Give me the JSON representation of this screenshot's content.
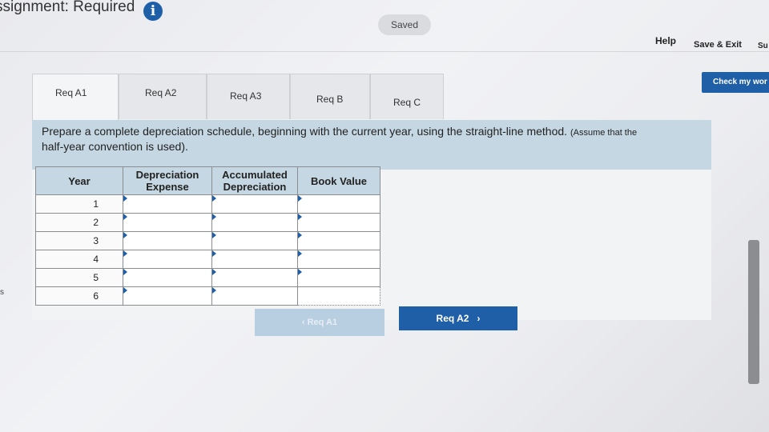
{
  "header": {
    "title": "ssignment: Required",
    "saved_label": "Saved",
    "help_label": "Help",
    "save_exit_label": "Save & Exit",
    "submit_label": "Su",
    "check_work_label": "Check my wor"
  },
  "tabs": [
    {
      "label": "Req A1",
      "active": true
    },
    {
      "label": "Req A2",
      "active": false
    },
    {
      "label": "Req A3",
      "active": false
    },
    {
      "label": "Req B",
      "active": false
    },
    {
      "label": "Req C",
      "active": false
    }
  ],
  "prompt": {
    "main": "Prepare a complete depreciation schedule, beginning with the current year, using the straight-line method.",
    "note": "(Assume that the",
    "line2": "half-year convention is used)."
  },
  "table": {
    "headers": {
      "year": "Year",
      "dep_expense_1": "Depreciation",
      "dep_expense_2": "Expense",
      "accum_1": "Accumulated",
      "accum_2": "Depreciation",
      "book_value": "Book Value"
    },
    "years": [
      "1",
      "2",
      "3",
      "4",
      "5",
      "6"
    ]
  },
  "nav": {
    "prev_label": "Req A1",
    "next_label": "Req A2"
  },
  "side_letter": "s",
  "colors": {
    "accent": "#1f5fa8",
    "header_bg": "#c5d7e2"
  }
}
